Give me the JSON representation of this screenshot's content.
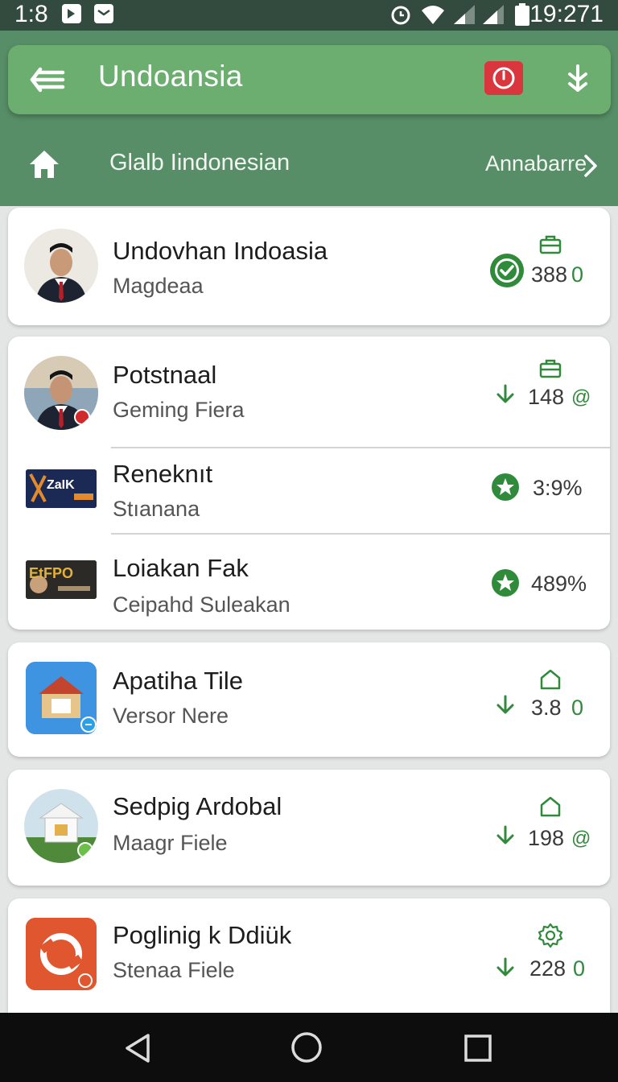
{
  "status_bar": {
    "left_time": "1:8",
    "right_time": "19:271"
  },
  "app_bar": {
    "title": "Undoansia"
  },
  "nav": {
    "title": "Glalb Iindonesian",
    "more_label": "Annabarre"
  },
  "items": [
    {
      "title": "Undovhan Indoasia",
      "subtitle": "Magdeaa",
      "stat": "388",
      "stat_suffix": "0",
      "top_icon": "briefcase-icon",
      "status_icon": "check-circle-icon"
    },
    {
      "title": "Potstnaal",
      "subtitle": "Geming Fiera",
      "stat": "148",
      "stat_suffix": "@",
      "top_icon": "briefcase-icon",
      "status_icon": "download-arrow-icon"
    },
    {
      "title": "Reneknıt",
      "subtitle": "Stıanana",
      "stat": "3:9%",
      "logo_text": "ZaIK",
      "status_icon": "star-badge-icon"
    },
    {
      "title": "Loiakan Fak",
      "subtitle": "Ceipahd Suleakan",
      "stat": "489%",
      "logo_text": "EtFPO",
      "status_icon": "star-badge-icon"
    },
    {
      "title": "Apatiha Tile",
      "subtitle": "Versor Nere",
      "stat": "3.8",
      "stat_suffix": "0",
      "top_icon": "house-icon",
      "status_icon": "download-arrow-icon"
    },
    {
      "title": "Sedpig Ardobal",
      "subtitle": "Maagr Fiele",
      "stat": "198",
      "stat_suffix": "@",
      "top_icon": "house-icon",
      "status_icon": "download-arrow-icon"
    },
    {
      "title": "Poglinig k Ddiük",
      "subtitle": "Stenaa Fiele",
      "stat": "228",
      "stat_suffix": "0",
      "top_icon": "gear-icon",
      "status_icon": "download-arrow-icon"
    }
  ],
  "colors": {
    "header": "#578d67",
    "app_bar": "#6cae6f",
    "accent_green": "#2f8a3a",
    "alert_red": "#d9363e",
    "status_bar": "#334a3e"
  }
}
